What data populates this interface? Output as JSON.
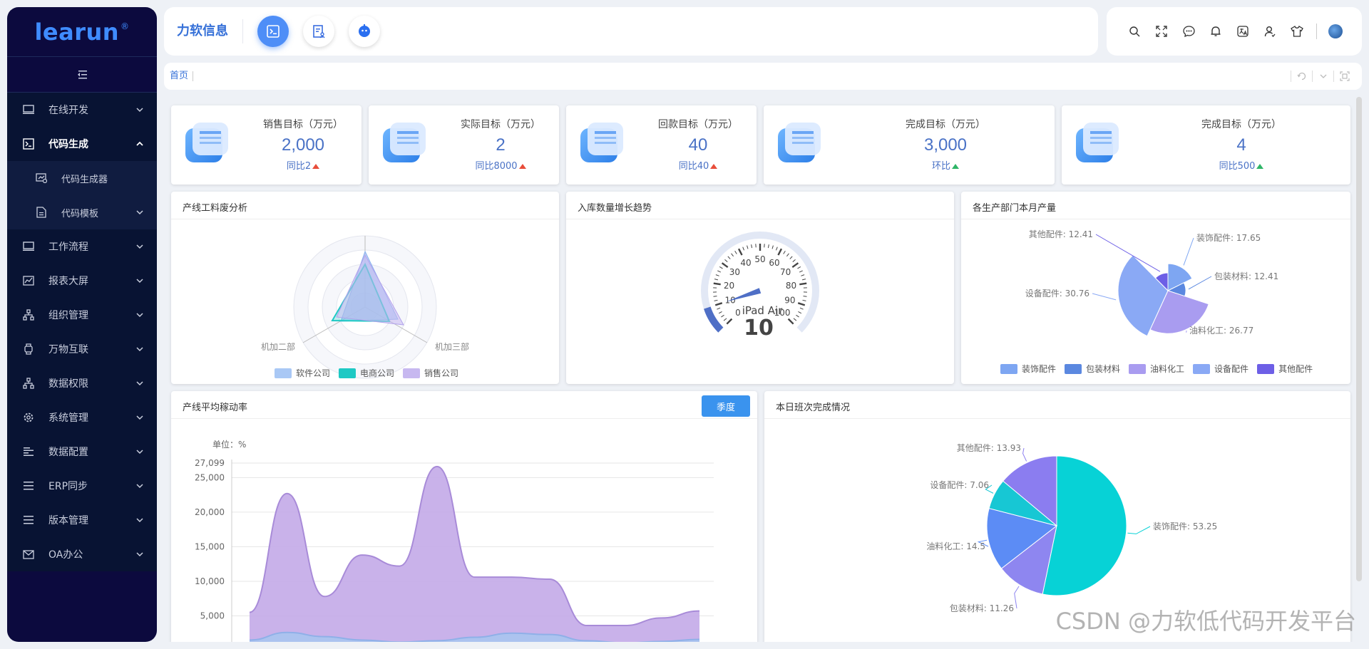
{
  "logo": {
    "text": "learun",
    "mark": "®"
  },
  "sidebar": {
    "items": [
      {
        "label": "在线开发",
        "icon": "monitor-icon"
      },
      {
        "label": "代码生成",
        "icon": "terminal-icon",
        "open": true,
        "children": [
          {
            "label": "代码生成器",
            "icon": "code-generator-icon"
          },
          {
            "label": "代码模板",
            "icon": "document-icon"
          }
        ]
      },
      {
        "label": "工作流程",
        "icon": "monitor-icon"
      },
      {
        "label": "报表大屏",
        "icon": "line-chart-icon"
      },
      {
        "label": "组织管理",
        "icon": "org-tree-icon"
      },
      {
        "label": "万物互联",
        "icon": "watch-icon"
      },
      {
        "label": "数据权限",
        "icon": "org-tree-icon"
      },
      {
        "label": "系统管理",
        "icon": "gear-icon"
      },
      {
        "label": "数据配置",
        "icon": "align-icon"
      },
      {
        "label": "ERP同步",
        "icon": "list-icon"
      },
      {
        "label": "版本管理",
        "icon": "list-icon"
      },
      {
        "label": "OA办公",
        "icon": "mail-icon"
      }
    ]
  },
  "header": {
    "brand": "力软信息"
  },
  "tabs": {
    "home": "首页"
  },
  "stats": [
    {
      "title": "销售目标（万元）",
      "value": "2,000",
      "compare": "同比2",
      "trend": "up",
      "trend_color": "#e84d3a"
    },
    {
      "title": "实际目标（万元）",
      "value": "2",
      "compare": "同比8000",
      "trend": "up",
      "trend_color": "#e84d3a"
    },
    {
      "title": "回款目标（万元）",
      "value": "40",
      "compare": "同比40",
      "trend": "up",
      "trend_color": "#e84d3a"
    },
    {
      "title": "完成目标（万元）",
      "value": "3,000",
      "compare": "环比",
      "trend": "up",
      "trend_color": "#2fb567"
    },
    {
      "title": "完成目标（万元）",
      "value": "4",
      "compare": "同比500",
      "trend": "up",
      "trend_color": "#2fb567"
    }
  ],
  "panels": {
    "radar_title": "产线工料废分析",
    "gauge_title": "入库数量增长趋势",
    "pie1_title": "各生产部门本月产量",
    "area_title": "产线平均稼动率",
    "area_button": "季度",
    "pie2_title": "本日班次完成情况"
  },
  "watermark": "CSDN @力软低代码开发平台",
  "chart_data": [
    {
      "type": "radar",
      "title": "产线工料废分析",
      "indicators": [
        "机加二部",
        "机加三部"
      ],
      "legend": [
        "软件公司",
        "电商公司",
        "销售公司"
      ],
      "colors": [
        "#a9c8f5",
        "#1ec9c4",
        "#c7b8f0"
      ],
      "legend_position": "bottom"
    },
    {
      "type": "gauge",
      "title": "入库数量增长趋势",
      "label": "iPad Air",
      "value": 10,
      "min": 0,
      "max": 100,
      "ticks": [
        0,
        10,
        20,
        30,
        40,
        50,
        60,
        70,
        80,
        90,
        100
      ]
    },
    {
      "type": "pie",
      "title": "各生产部门本月产量",
      "rose": true,
      "labels": [
        "装饰配件",
        "包装材料",
        "油料化工",
        "设备配件",
        "其他配件"
      ],
      "values": [
        17.65,
        12.41,
        26.77,
        30.76,
        12.41
      ],
      "colors": [
        "#7ea6f2",
        "#5b88e0",
        "#a99cf0",
        "#8aa9f5",
        "#6d5fe6"
      ],
      "legend_position": "bottom"
    },
    {
      "type": "area",
      "title": "产线平均稼动率",
      "unit": "单位：%",
      "ylim": [
        0,
        27099
      ],
      "yticks": [
        "27,099",
        "25,000",
        "20,000",
        "15,000",
        "10,000",
        "5,000"
      ],
      "ytick_values": [
        27099,
        25000,
        20000,
        15000,
        10000,
        5000
      ],
      "series": [
        {
          "values": [
            5500,
            22700,
            7800,
            13800,
            12200,
            26600,
            10600,
            10600,
            10300,
            3600,
            3600,
            4700,
            5700
          ],
          "color": "#c3aae8"
        },
        {
          "values": [
            1500,
            2600,
            2000,
            1500,
            1200,
            1400,
            1900,
            2500,
            2300,
            1400,
            1100,
            1300,
            1600
          ],
          "color": "#a8c4f0"
        }
      ]
    },
    {
      "type": "pie",
      "title": "本日班次完成情况",
      "labels": [
        "装饰配件",
        "包装材料",
        "油料化工",
        "设备配件",
        "其他配件"
      ],
      "values": [
        53.25,
        11.26,
        14.5,
        7.06,
        13.93
      ],
      "colors": [
        "#07d2d6",
        "#8e86f0",
        "#5c8cf5",
        "#17c7d4",
        "#8b7df0"
      ]
    }
  ]
}
